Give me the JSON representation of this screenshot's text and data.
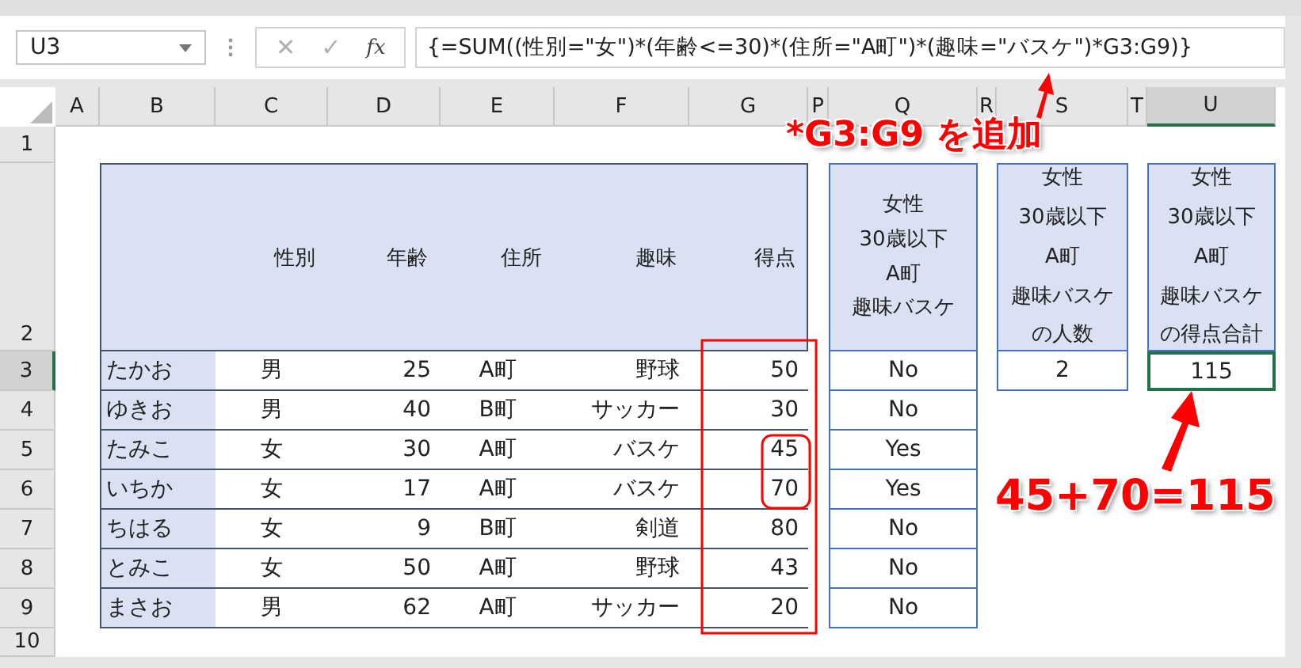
{
  "name_box": {
    "value": "U3"
  },
  "formula_bar": {
    "cancel": "✕",
    "enter": "✓",
    "fx": "fx",
    "formula": "{=SUM((性別=\"女\")*(年齢<=30)*(住所=\"A町\")*(趣味=\"バスケ\")*G3:G9)}"
  },
  "column_headers": [
    {
      "label": "A",
      "selected": false
    },
    {
      "label": "B",
      "selected": false
    },
    {
      "label": "C",
      "selected": false
    },
    {
      "label": "D",
      "selected": false
    },
    {
      "label": "E",
      "selected": false
    },
    {
      "label": "F",
      "selected": false
    },
    {
      "label": "G",
      "selected": false
    },
    {
      "label": "P",
      "selected": false
    },
    {
      "label": "Q",
      "selected": false
    },
    {
      "label": "R",
      "selected": false
    },
    {
      "label": "S",
      "selected": false
    },
    {
      "label": "T",
      "selected": false
    },
    {
      "label": "U",
      "selected": true
    }
  ],
  "row_headers": [
    {
      "label": "1",
      "selected": false
    },
    {
      "label": "2",
      "selected": false
    },
    {
      "label": "3",
      "selected": true
    },
    {
      "label": "4",
      "selected": false
    },
    {
      "label": "5",
      "selected": false
    },
    {
      "label": "6",
      "selected": false
    },
    {
      "label": "7",
      "selected": false
    },
    {
      "label": "8",
      "selected": false
    },
    {
      "label": "9",
      "selected": false
    },
    {
      "label": "10",
      "selected": false
    }
  ],
  "table": {
    "columns": [
      "性別",
      "年齢",
      "住所",
      "趣味",
      "得点"
    ],
    "rows": [
      {
        "name": "たかお",
        "gender": "男",
        "age": "25",
        "address": "A町",
        "hobby": "野球",
        "score": "50"
      },
      {
        "name": "ゆきお",
        "gender": "男",
        "age": "40",
        "address": "B町",
        "hobby": "サッカー",
        "score": "30"
      },
      {
        "name": "たみこ",
        "gender": "女",
        "age": "30",
        "address": "A町",
        "hobby": "バスケ",
        "score": "45"
      },
      {
        "name": "いちか",
        "gender": "女",
        "age": "17",
        "address": "A町",
        "hobby": "バスケ",
        "score": "70"
      },
      {
        "name": "ちはる",
        "gender": "女",
        "age": "9",
        "address": "B町",
        "hobby": "剣道",
        "score": "80"
      },
      {
        "name": "とみこ",
        "gender": "女",
        "age": "50",
        "address": "A町",
        "hobby": "野球",
        "score": "43"
      },
      {
        "name": "まさお",
        "gender": "男",
        "age": "62",
        "address": "A町",
        "hobby": "サッカー",
        "score": "20"
      }
    ]
  },
  "condition_column": {
    "header": [
      "女性",
      "30歳以下",
      "A町",
      "趣味バスケ"
    ],
    "values": [
      "No",
      "No",
      "Yes",
      "Yes",
      "No",
      "No",
      "No"
    ]
  },
  "count_box": {
    "header": [
      "女性",
      "30歳以下",
      "A町",
      "趣味バスケ",
      "の人数"
    ],
    "value": "2",
    "selected": false
  },
  "sum_box": {
    "header": [
      "女性",
      "30歳以下",
      "A町",
      "趣味バスケ",
      "の得点合計"
    ],
    "value": "115",
    "selected": true
  },
  "annotations": [
    {
      "kind": "formula-note",
      "text": "*G3:G9 を追加"
    },
    {
      "kind": "result-note",
      "text": "45+70=115"
    }
  ]
}
